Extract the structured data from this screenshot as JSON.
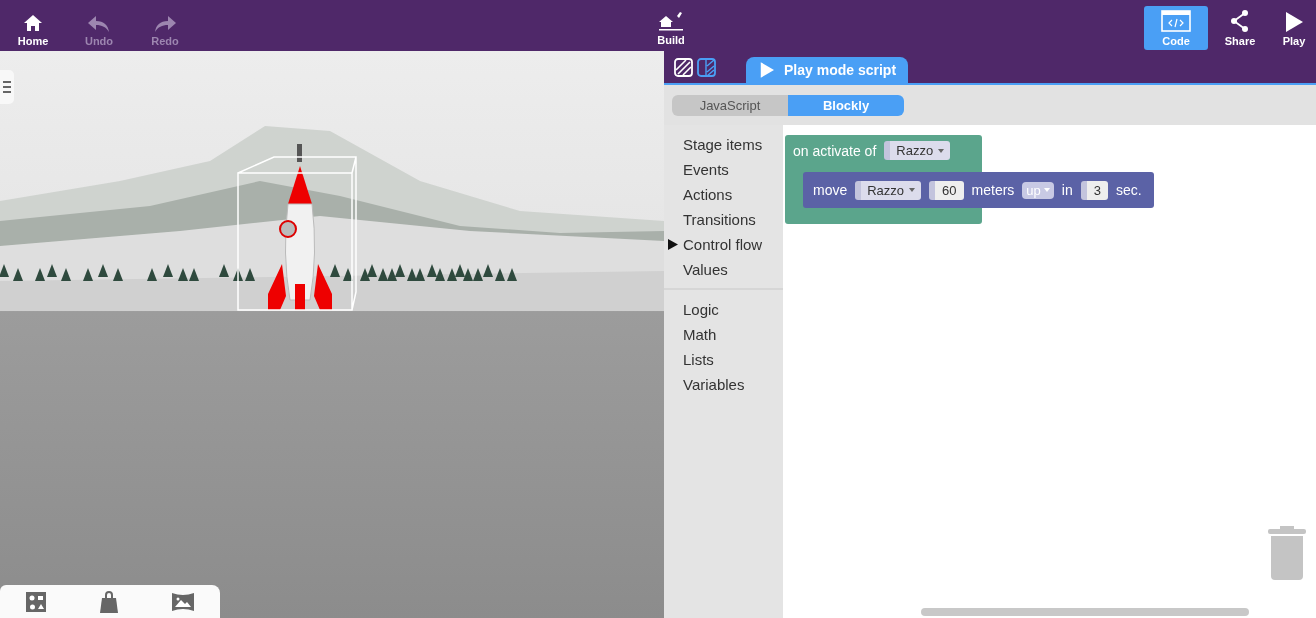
{
  "toolbar": {
    "left_buttons": [
      {
        "label": "Home",
        "disabled": false
      },
      {
        "label": "Undo",
        "disabled": true
      },
      {
        "label": "Redo",
        "disabled": true
      }
    ],
    "center_button": {
      "label": "Build"
    },
    "right_buttons": [
      {
        "label": "Code",
        "selected": true
      },
      {
        "label": "Share",
        "selected": false
      },
      {
        "label": "Play",
        "selected": false
      }
    ]
  },
  "code_panel": {
    "script_tab": {
      "label": "Play mode script",
      "selected": true
    },
    "editor_modes": [
      {
        "label": "JavaScript",
        "selected": false
      },
      {
        "label": "Blockly",
        "selected": true
      }
    ],
    "toolbox": [
      [
        {
          "label": "Stage items",
          "selected": false
        },
        {
          "label": "Events",
          "selected": false
        },
        {
          "label": "Actions",
          "selected": false
        },
        {
          "label": "Transitions",
          "selected": false
        },
        {
          "label": "Control flow",
          "selected": true
        },
        {
          "label": "Values",
          "selected": false
        }
      ],
      [
        {
          "label": "Logic",
          "selected": false
        },
        {
          "label": "Math",
          "selected": false
        },
        {
          "label": "Lists",
          "selected": false
        },
        {
          "label": "Variables",
          "selected": false
        }
      ]
    ],
    "event_block": {
      "label": "on activate of",
      "target": "Razzo"
    },
    "action_block": {
      "parts": [
        {
          "kind": "label",
          "text": "move"
        },
        {
          "kind": "dropdown",
          "text": "Razzo"
        },
        {
          "kind": "number",
          "text": "60"
        },
        {
          "kind": "label",
          "text": "meters"
        },
        {
          "kind": "inline_dropdown",
          "text": "up"
        },
        {
          "kind": "label",
          "text": "in"
        },
        {
          "kind": "number",
          "text": "3"
        },
        {
          "kind": "label",
          "text": "sec."
        }
      ]
    }
  }
}
